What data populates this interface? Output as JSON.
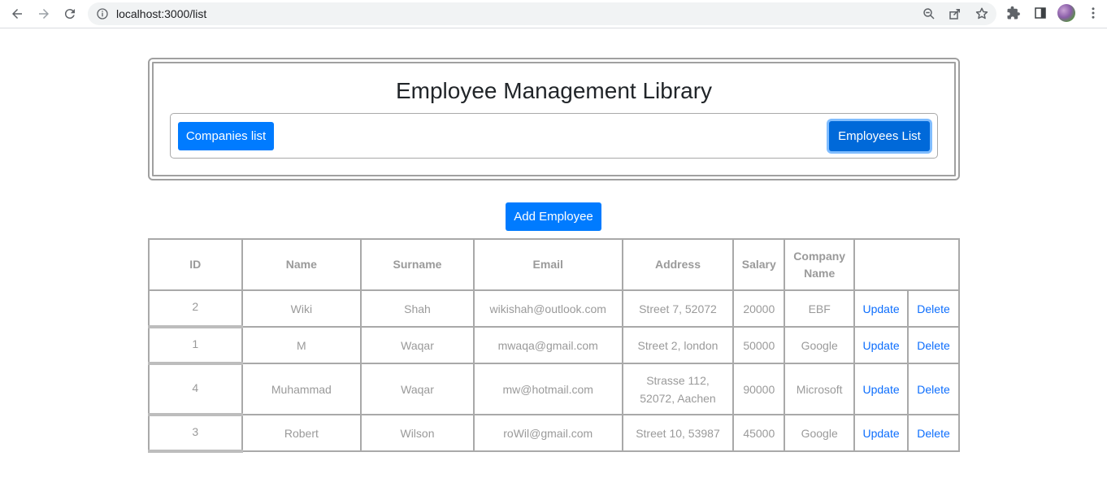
{
  "browser": {
    "url": "localhost:3000/list"
  },
  "app": {
    "title": "Employee Management Library",
    "nav": {
      "companies_label": "Companies list",
      "employees_label": "Employees List"
    },
    "add_label": "Add Employee"
  },
  "table": {
    "headers": [
      "ID",
      "Name",
      "Surname",
      "Email",
      "Address",
      "Salary",
      "Company Name"
    ],
    "company_header_lines": [
      "Company",
      "Name"
    ],
    "rows": [
      {
        "id": "2",
        "name": "Wiki",
        "surname": "Shah",
        "email": "wikishah@outlook.com",
        "address": "Street 7, 52072",
        "salary": "20000",
        "company": "EBF",
        "update": "Update",
        "delete": "Delete"
      },
      {
        "id": "1",
        "name": "M",
        "surname": "Waqar",
        "email": "mwaqa@gmail.com",
        "address": "Street 2, london",
        "salary": "50000",
        "company": "Google",
        "update": "Update",
        "delete": "Delete"
      },
      {
        "id": "4",
        "name": "Muhammad",
        "surname": "Waqar",
        "email": "mw@hotmail.com",
        "address": "Strasse 112, 52072, Aachen",
        "salary": "90000",
        "company": "Microsoft",
        "update": "Update",
        "delete": "Delete"
      },
      {
        "id": "3",
        "name": "Robert",
        "surname": "Wilson",
        "email": "roWil@gmail.com",
        "address": "Street 10, 53987",
        "salary": "45000",
        "company": "Google",
        "update": "Update",
        "delete": "Delete"
      }
    ]
  },
  "colors": {
    "primary": "#007bff",
    "primary_active": "#0069d9",
    "link": "#0d6efd",
    "border": "#a9a9a9",
    "text_muted": "#9a9a9a"
  }
}
